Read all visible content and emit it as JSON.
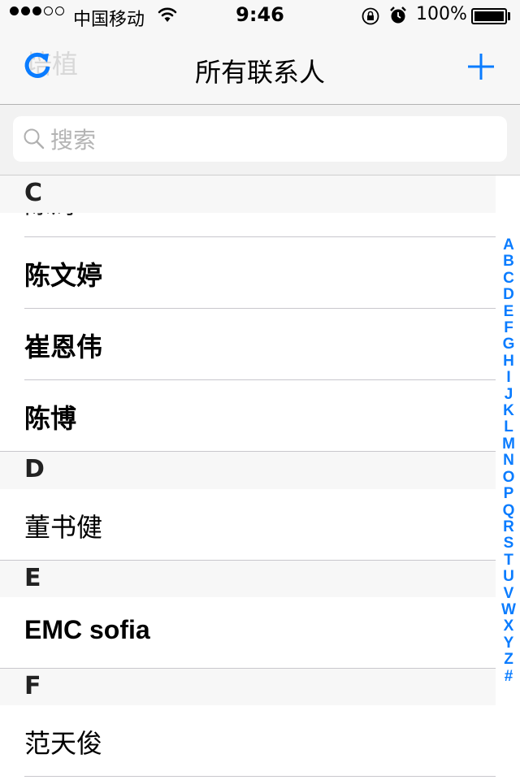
{
  "status_bar": {
    "carrier": "中国移动",
    "time": "9:46",
    "battery": "100%",
    "signal_bars_filled": 3,
    "signal_bars_total": 5
  },
  "nav": {
    "title": "所有联系人",
    "ghost_text": "培植",
    "left_icon": "refresh-icon",
    "right_icon": "plus-icon",
    "accent_color": "#0a7cff"
  },
  "search": {
    "placeholder": "搜索",
    "value": ""
  },
  "partial_row": "陈涛",
  "sections": [
    {
      "letter": "C",
      "contacts": [
        {
          "name": "陈文婷",
          "bold": true
        },
        {
          "name": "崔恩伟",
          "bold": true
        },
        {
          "name": "陈博",
          "bold": true
        }
      ]
    },
    {
      "letter": "D",
      "contacts": [
        {
          "name": "董书健",
          "bold": false
        }
      ]
    },
    {
      "letter": "E",
      "contacts": [
        {
          "name": "EMC sofia",
          "bold": true
        }
      ]
    },
    {
      "letter": "F",
      "contacts": [
        {
          "name": "范天俊",
          "bold": false
        }
      ]
    }
  ],
  "index_letters": [
    "A",
    "B",
    "C",
    "D",
    "E",
    "F",
    "G",
    "H",
    "I",
    "J",
    "K",
    "L",
    "M",
    "N",
    "O",
    "P",
    "Q",
    "R",
    "S",
    "T",
    "U",
    "V",
    "W",
    "X",
    "Y",
    "Z",
    "#"
  ]
}
